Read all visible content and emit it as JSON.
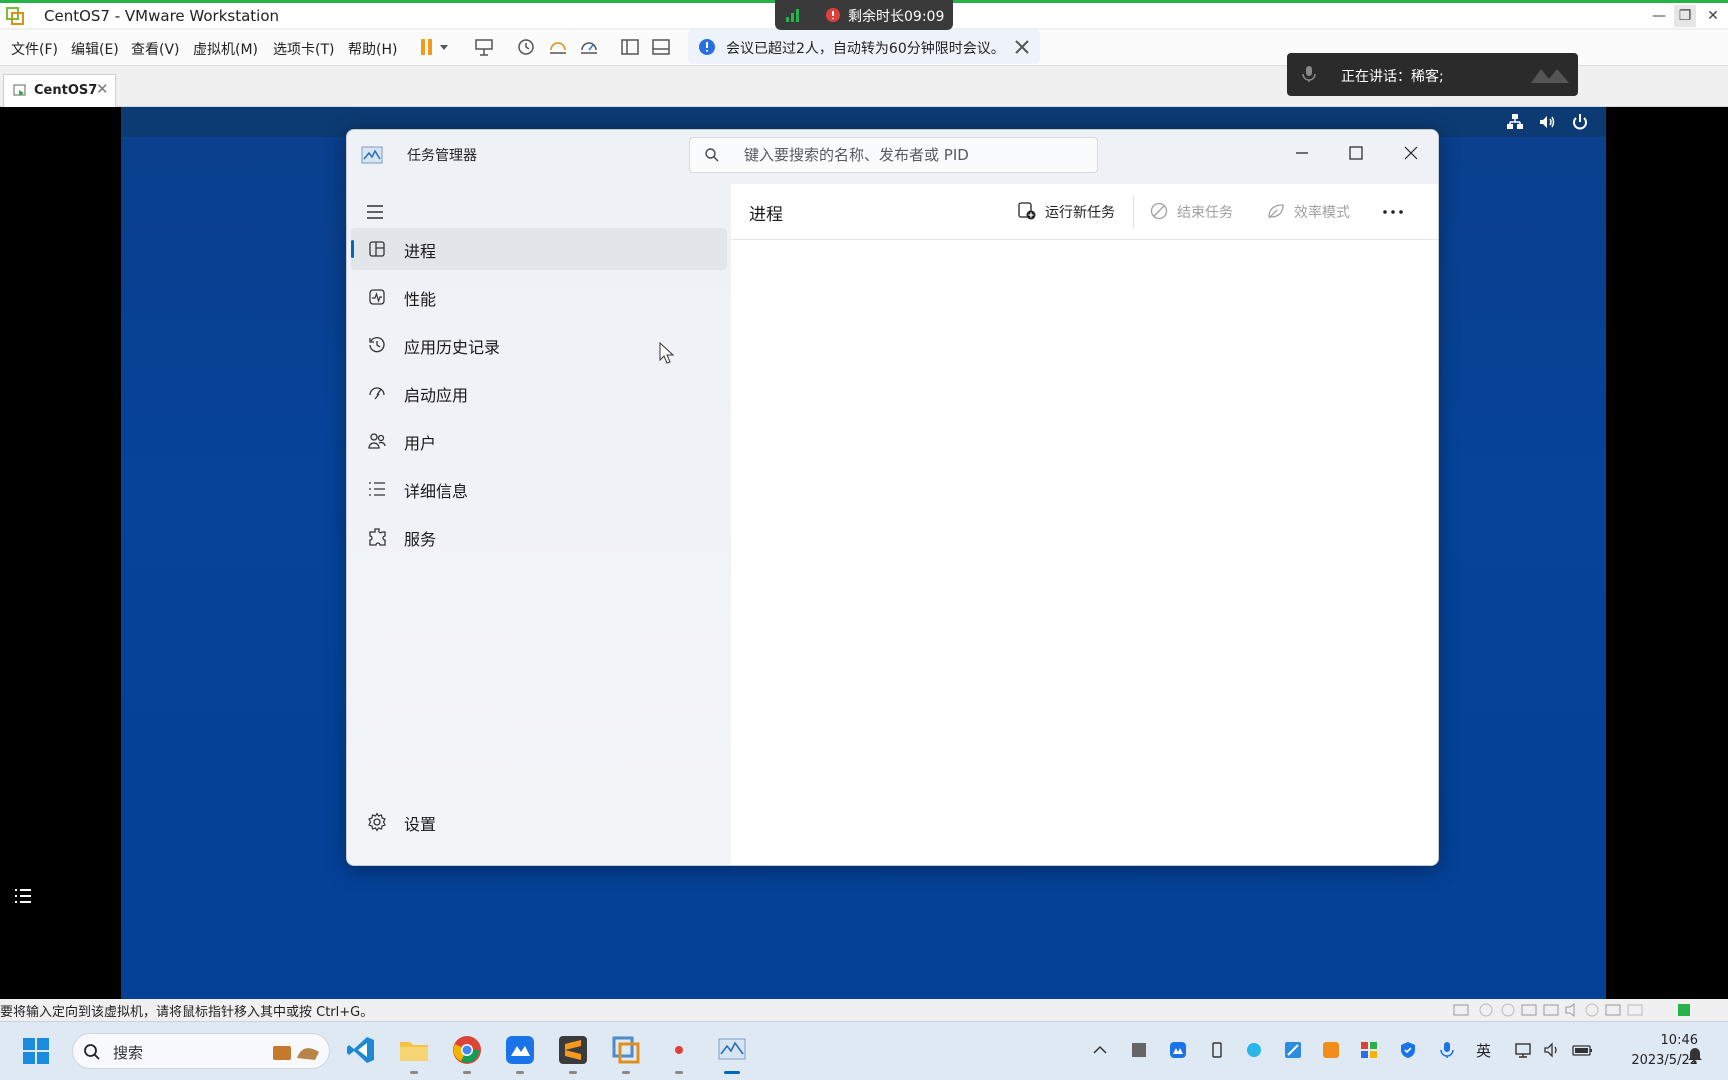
{
  "vmware": {
    "window_title": "CentOS7 - VMware Workstation",
    "menu": [
      "文件(F)",
      "编辑(E)",
      "查看(V)",
      "虚拟机(M)",
      "选项卡(T)",
      "帮助(H)"
    ],
    "tab_label": "CentOS7",
    "status_text": "要将输入定向到该虚拟机，请将鼠标指针移入其中或按 Ctrl+G。"
  },
  "meeting": {
    "timer_text": "剩余时长09:09",
    "notice_text": "会议已超过2人，自动转为60分钟限时会议。",
    "speaking_text": "正在讲话：稀客;"
  },
  "task_manager": {
    "title": "任务管理器",
    "search_placeholder": "键入要搜索的名称、发布者或 PID",
    "nav": [
      {
        "label": "进程",
        "icon": "processes-icon",
        "active": true
      },
      {
        "label": "性能",
        "icon": "performance-icon",
        "active": false
      },
      {
        "label": "应用历史记录",
        "icon": "app-history-icon",
        "active": false
      },
      {
        "label": "启动应用",
        "icon": "startup-apps-icon",
        "active": false
      },
      {
        "label": "用户",
        "icon": "users-icon",
        "active": false
      },
      {
        "label": "详细信息",
        "icon": "details-icon",
        "active": false
      },
      {
        "label": "服务",
        "icon": "services-icon",
        "active": false
      }
    ],
    "settings_label": "设置",
    "page_title": "进程",
    "actions": {
      "run_new_task": "运行新任务",
      "end_task": "结束任务",
      "efficiency_mode": "效率模式"
    }
  },
  "taskbar": {
    "search_label": "搜索",
    "tray_lang": "英",
    "time": "10:46",
    "date": "2023/5/22"
  },
  "colors": {
    "accent": "#0067c0",
    "guest_background": "#034197",
    "vmware_green": "#27b34a",
    "disabled_text": "#a0a0a0"
  }
}
